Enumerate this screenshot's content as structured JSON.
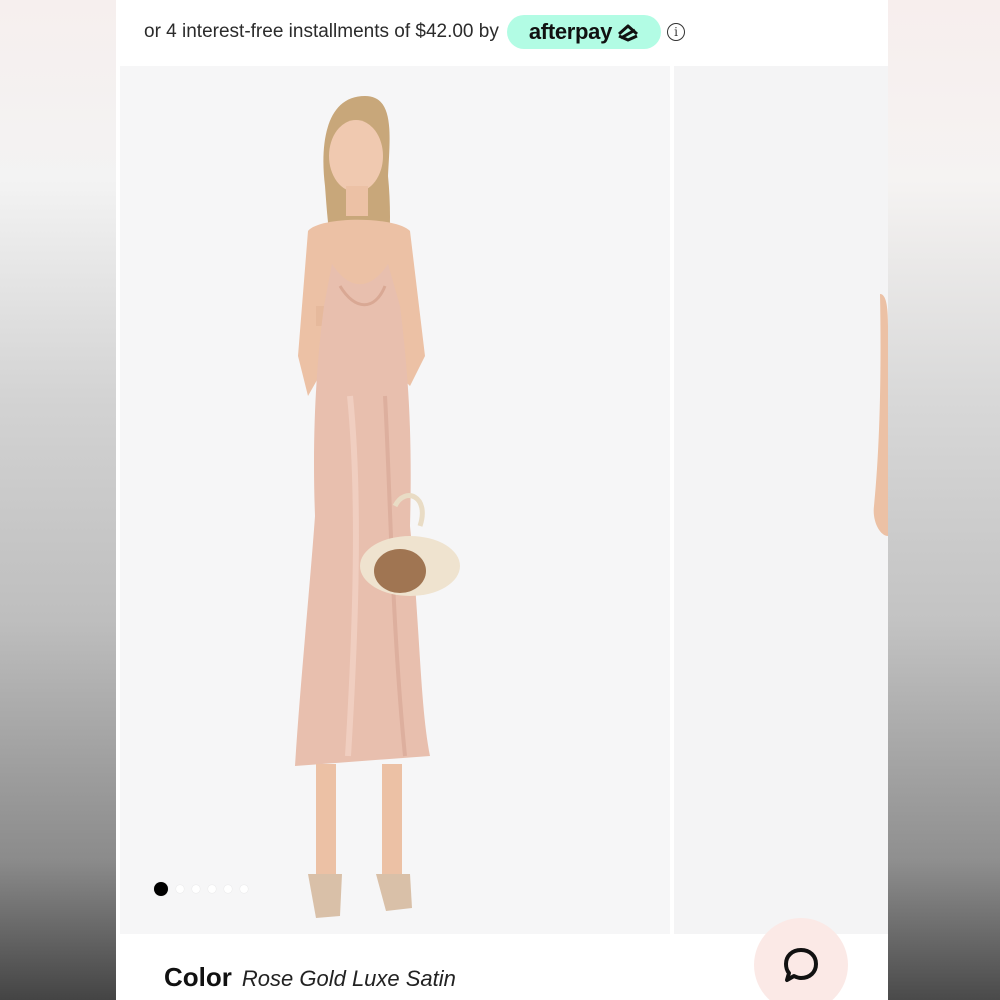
{
  "afterpay": {
    "text": "or 4 interest-free installments of $42.00 by",
    "brand": "afterpay",
    "badge_color": "#b2fce4",
    "info_glyph": "i"
  },
  "gallery": {
    "slide_count": 6,
    "active_index": 0,
    "main_image_alt": "Model wearing rose gold satin slip midi dress holding dried flower bouquet",
    "next_image_alt": "Next product image"
  },
  "product": {
    "color_label": "Color",
    "color_value": "Rose Gold Luxe Satin"
  },
  "chat": {
    "icon": "chat-bubble-icon",
    "accent": "#fbe9e6"
  }
}
